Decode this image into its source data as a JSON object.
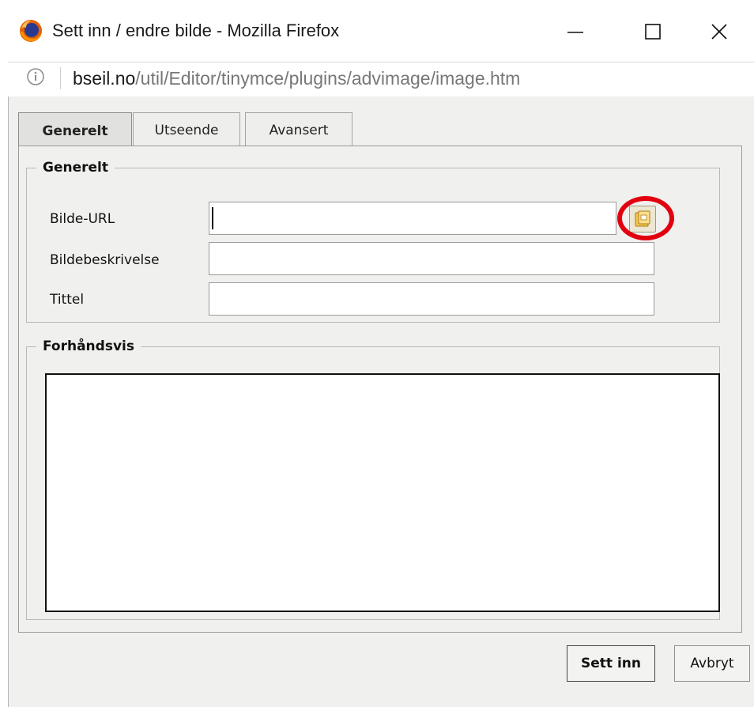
{
  "window": {
    "title": "Sett inn / endre bilde - Mozilla Firefox",
    "minimize_icon": "minimize-icon",
    "maximize_icon": "maximize-icon",
    "close_icon": "close-icon"
  },
  "urlbar": {
    "info_icon": "info-icon",
    "domain": "bseil.no",
    "path": "/util/Editor/tinymce/plugins/advimage/image.htm"
  },
  "tabs": [
    {
      "label": "Generelt",
      "active": true
    },
    {
      "label": "Utseende",
      "active": false
    },
    {
      "label": "Avansert",
      "active": false
    }
  ],
  "general": {
    "legend": "Generelt",
    "url_label": "Bilde-URL",
    "url_value": "",
    "desc_label": "Bildebeskrivelse",
    "desc_value": "",
    "title_label": "Tittel",
    "title_value": "",
    "browse_icon": "folder-browse-icon"
  },
  "preview": {
    "legend": "Forhåndsvis"
  },
  "buttons": {
    "insert_label": "Sett inn",
    "cancel_label": "Avbryt"
  },
  "colors": {
    "highlight": "#e2000f",
    "dialog_bg": "#f0f0ee",
    "url_path": "#777777"
  }
}
